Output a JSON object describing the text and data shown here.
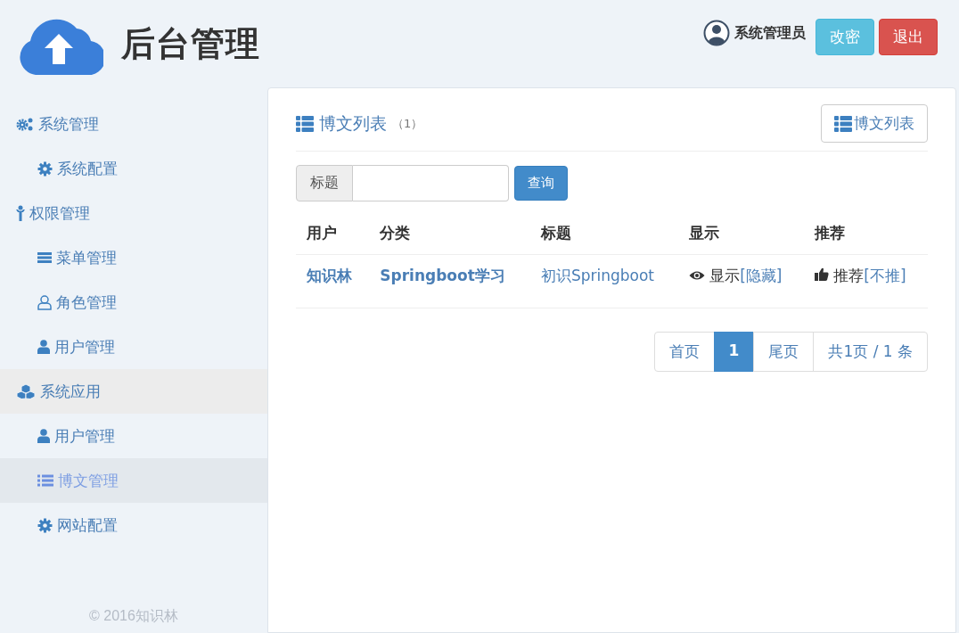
{
  "header": {
    "title": "后台管理",
    "user": "系统管理员",
    "buttons": [
      {
        "label": "改密",
        "kind": "info"
      },
      {
        "label": "退出",
        "kind": "danger"
      }
    ]
  },
  "sidebar": {
    "groups": [
      {
        "label": "系统管理",
        "active": false,
        "children": [
          {
            "label": "系统配置",
            "selected": false
          }
        ]
      },
      {
        "label": "权限管理",
        "active": false,
        "children": [
          {
            "label": "菜单管理",
            "selected": false
          },
          {
            "label": "角色管理",
            "selected": false
          },
          {
            "label": "用户管理",
            "selected": false
          }
        ]
      },
      {
        "label": "系统应用",
        "active": true,
        "children": [
          {
            "label": "用户管理",
            "selected": false
          },
          {
            "label": "博文管理",
            "selected": true
          },
          {
            "label": "网站配置",
            "selected": false
          }
        ]
      }
    ],
    "footer": "© 2016知识林"
  },
  "panel": {
    "title": "博文列表",
    "count": "（1）",
    "button": "博文列表",
    "search": {
      "label": "标题",
      "button": "查询"
    },
    "table": {
      "columns": [
        "用户",
        "分类",
        "标题",
        "显示",
        "推荐"
      ],
      "rows": [
        {
          "user": "知识林",
          "category": "Springboot学习",
          "title": "初识Springboot",
          "show": {
            "text": "显示",
            "link": "[隐藏]"
          },
          "recommend": {
            "text": "推荐",
            "link": "[不推]"
          }
        }
      ]
    },
    "pagination": [
      {
        "label": "首页",
        "selected": false
      },
      {
        "label": "1",
        "selected": true
      },
      {
        "label": "尾页",
        "selected": false
      },
      {
        "label": "共1页 / 1 条",
        "selected": false
      }
    ]
  }
}
